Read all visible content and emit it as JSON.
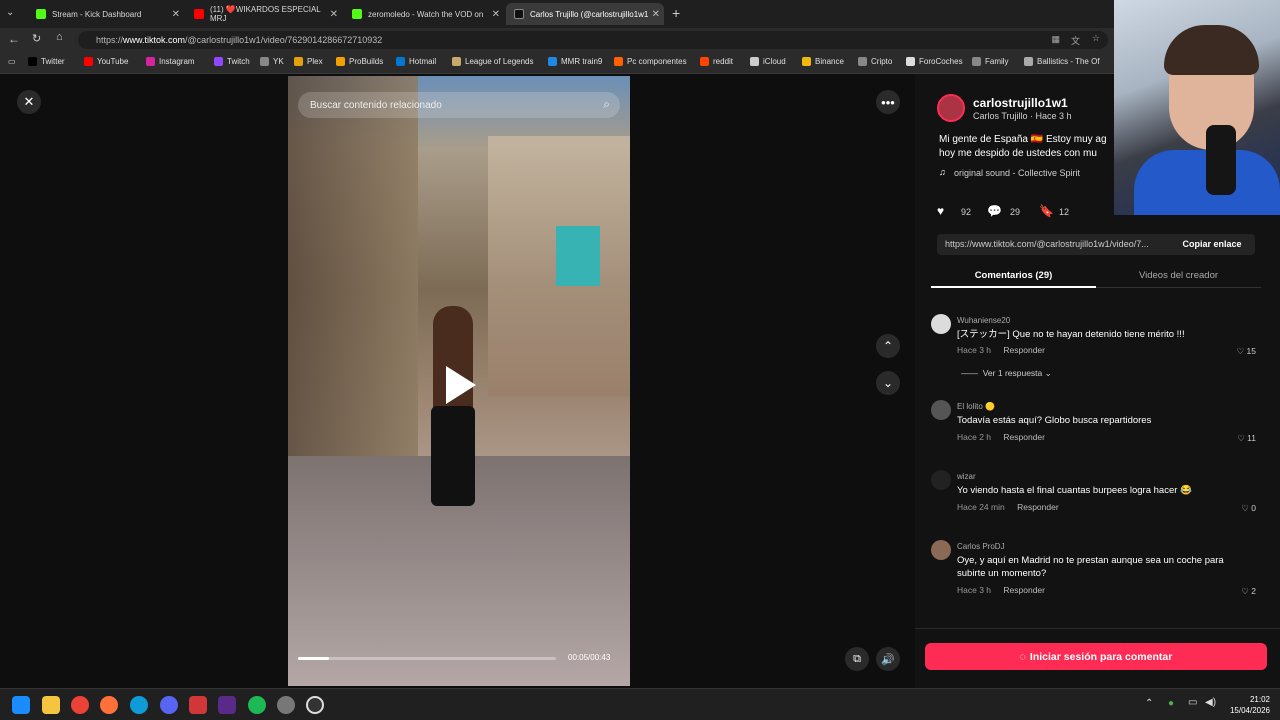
{
  "browser": {
    "tabs": [
      {
        "label": "Stream - Kick Dashboard",
        "color": "#53fc18",
        "active": false
      },
      {
        "label": "(11) ❤️WIKARDOS ESPECIAL MRJ",
        "color": "#ff0000",
        "active": false
      },
      {
        "label": "zeromoledo - Watch the VOD on",
        "color": "#53fc18",
        "active": false
      },
      {
        "label": "Carlos Trujillo (@carlostrujillo1w1)",
        "color": "#000000",
        "active": true
      }
    ],
    "url_prefix": "https://",
    "url_domain": "www.tiktok.com",
    "url_path": "/@carlostrujillo1w1/video/7629014286672710932",
    "bookmarks": [
      {
        "label": "Twitter",
        "color": "#000000"
      },
      {
        "label": "YouTube",
        "color": "#ff0000"
      },
      {
        "label": "Instagram",
        "color": "#d6249f"
      },
      {
        "label": "Twitch",
        "color": "#9146ff"
      },
      {
        "label": "YK",
        "color": "#888888"
      },
      {
        "label": "Plex",
        "color": "#e5a00d"
      },
      {
        "label": "ProBuilds",
        "color": "#f0a000"
      },
      {
        "label": "Hotmail",
        "color": "#0078d4"
      },
      {
        "label": "League of Legends",
        "color": "#c8aa6e"
      },
      {
        "label": "MMR train9",
        "color": "#1e88e5"
      },
      {
        "label": "Pc componentes",
        "color": "#ff6000"
      },
      {
        "label": "reddit",
        "color": "#ff4500"
      },
      {
        "label": "iCloud",
        "color": "#cccccc"
      },
      {
        "label": "Binance",
        "color": "#f0b90b"
      },
      {
        "label": "Cripto",
        "color": "#888888"
      },
      {
        "label": "ForoCoches",
        "color": "#dddddd"
      },
      {
        "label": "Family",
        "color": "#888888"
      },
      {
        "label": "Ballistics - The Of",
        "color": "#aaaaaa"
      }
    ]
  },
  "video": {
    "search_placeholder": "Buscar contenido relacionado",
    "timecode": "00:05/00:43",
    "progress": 0.12
  },
  "post": {
    "username": "carlostrujillo1w1",
    "display": "Carlos Trujillo · Hace 3 h",
    "caption_line1": "Mi gente de España 🇪🇸 Estoy muy ag",
    "caption_line2": "hoy me despido de ustedes con mu",
    "sound": "original sound - Collective Spirit",
    "likes": "92",
    "comments": "29",
    "saves": "12",
    "share_url": "https://www.tiktok.com/@carlostrujillo1w1/video/7...",
    "copy_label": "Copiar enlace",
    "tab_comments": "Comentarios (29)",
    "tab_videos": "Videos del creador"
  },
  "comments": [
    {
      "user": "Wuhaniense20",
      "text": "[ステッカー] Que no te hayan detenido tiene mérito !!!",
      "time": "Hace 3 h",
      "reply": "Responder",
      "likes": "15",
      "replies_label": "Ver 1 respuesta"
    },
    {
      "user": "El lolito 🟡",
      "text": "Todavía estás aquí? Globo busca repartidores",
      "time": "Hace 2 h",
      "reply": "Responder",
      "likes": "11"
    },
    {
      "user": "wizar",
      "text": "Yo viendo hasta el final cuantas burpees logra hacer 😂",
      "time": "Hace 24 min",
      "reply": "Responder",
      "likes": "0"
    },
    {
      "user": "Carlos ProDJ",
      "text": "Oye, y aquí en Madrid no te prestan aunque sea un coche para subirte un momento?",
      "time": "Hace 3 h",
      "reply": "Responder",
      "likes": "2"
    }
  ],
  "login_button": "Iniciar sesión para comentar",
  "taskbar": {
    "time": "21:02",
    "date": "15/04/2026"
  }
}
